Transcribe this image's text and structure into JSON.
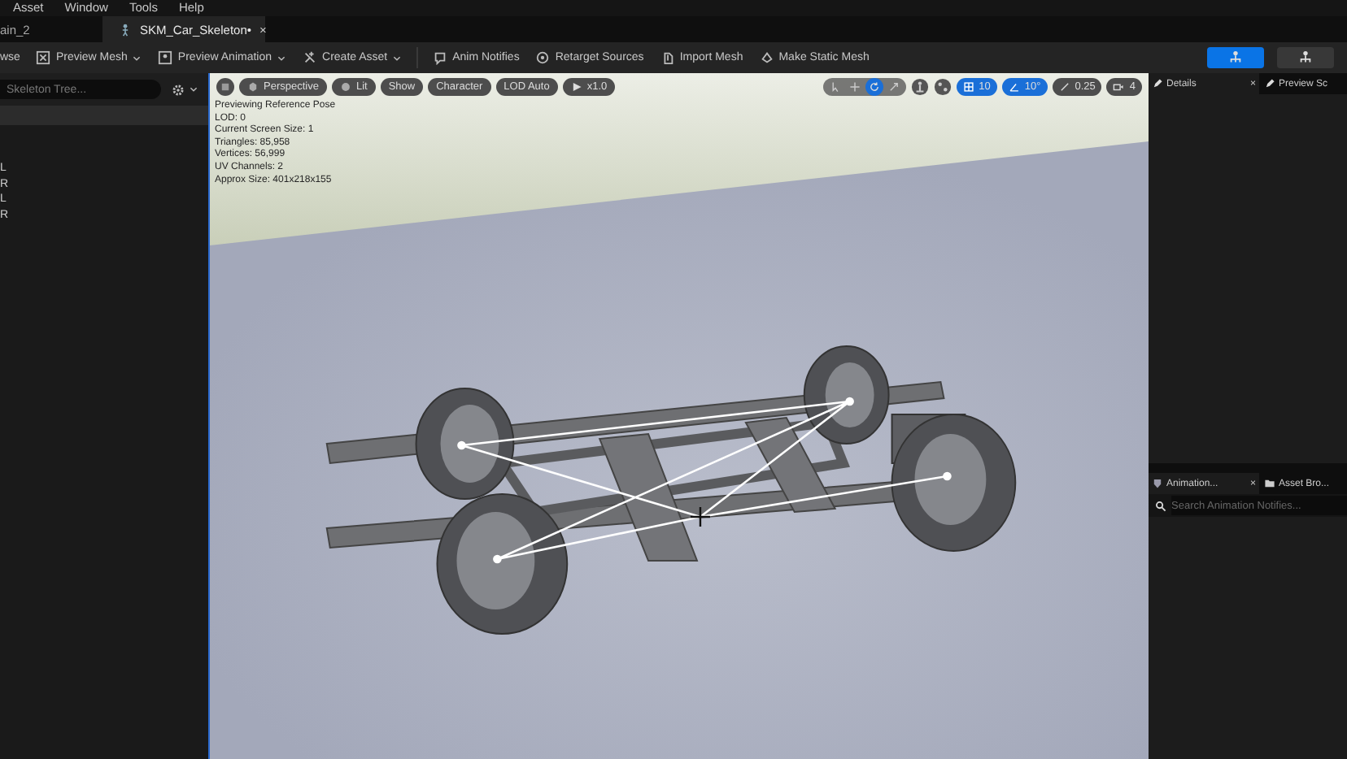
{
  "menu": [
    "Asset",
    "Window",
    "Tools",
    "Help"
  ],
  "tabs": [
    {
      "label": "ain_2",
      "selected": false
    },
    {
      "label": "SKM_Car_Skeleton•",
      "selected": true,
      "close": "×"
    }
  ],
  "toolbar": [
    {
      "label": "wse",
      "kind": "text"
    },
    {
      "label": "Preview Mesh",
      "kind": "dropdown"
    },
    {
      "label": "Preview Animation",
      "kind": "dropdown"
    },
    {
      "label": "Create Asset",
      "kind": "dropdown"
    },
    {
      "label": "Anim Notifies",
      "kind": "button"
    },
    {
      "label": "Retarget Sources",
      "kind": "button"
    },
    {
      "label": "Import Mesh",
      "kind": "button"
    },
    {
      "label": "Make Static Mesh",
      "kind": "button"
    }
  ],
  "mode_buttons": [
    {
      "selected": true
    },
    {
      "selected": false
    }
  ],
  "skeleton_tree": {
    "placeholder": "Skeleton Tree...",
    "rows": [
      "L",
      "R",
      "L",
      "R"
    ]
  },
  "viewport": {
    "buttons": [
      {
        "kind": "menu"
      },
      {
        "label": "Perspective",
        "kind": "camera"
      },
      {
        "label": "Lit",
        "kind": "lit"
      },
      {
        "label": "Show",
        "kind": "plain"
      },
      {
        "label": "Character",
        "kind": "plain"
      },
      {
        "label": "LOD Auto",
        "kind": "plain"
      },
      {
        "label": "x1.0",
        "kind": "play"
      }
    ],
    "stats": [
      "Previewing Reference Pose",
      "LOD: 0",
      "Current Screen Size: 1",
      "Triangles: 85,958",
      "Vertices: 56,999",
      "UV Channels: 2",
      "Approx Size: 401x218x155"
    ],
    "tools": [
      {
        "kind": "select",
        "selected": false
      },
      {
        "kind": "move",
        "selected": false
      },
      {
        "kind": "rotate",
        "selected": true
      },
      {
        "kind": "scale",
        "selected": false
      }
    ],
    "snaps": [
      {
        "kind": "grid",
        "label": "10",
        "on": true
      },
      {
        "kind": "angle",
        "label": "10°",
        "on": true
      },
      {
        "kind": "scale",
        "label": "0.25",
        "on": false
      },
      {
        "kind": "camera",
        "label": "4",
        "on": false
      }
    ]
  },
  "details_tabs": [
    {
      "label": "Details",
      "selected": true,
      "close": "×"
    },
    {
      "label": "Preview Sc",
      "selected": false
    }
  ],
  "notifies_tabs": [
    {
      "label": "Animation...",
      "selected": true,
      "close": "×"
    },
    {
      "label": "Asset Bro...",
      "selected": false
    }
  ],
  "notifies_search": {
    "placeholder": "Search Animation Notifies..."
  }
}
